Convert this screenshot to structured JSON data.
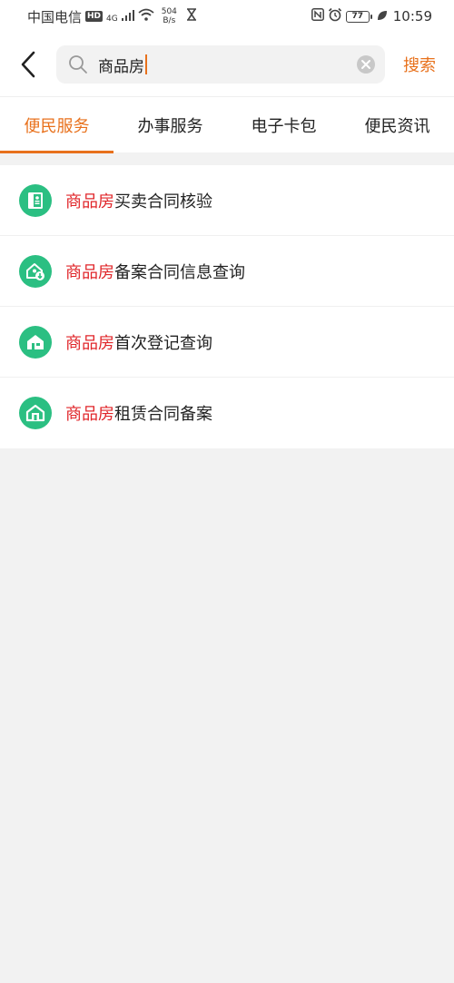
{
  "status_bar": {
    "carrier": "中国电信",
    "hd": "HD",
    "network": "4G",
    "speed_value": "504",
    "speed_unit": "B/s",
    "battery": "77",
    "time": "10:59"
  },
  "search": {
    "query": "商品房",
    "button_label": "搜索"
  },
  "tabs": [
    {
      "label": "便民服务",
      "active": true
    },
    {
      "label": "办事服务",
      "active": false
    },
    {
      "label": "电子卡包",
      "active": false
    },
    {
      "label": "便民资讯",
      "active": false
    }
  ],
  "results": [
    {
      "highlight": "商品房",
      "rest": "买卖合同核验",
      "icon": "contract-icon"
    },
    {
      "highlight": "商品房",
      "rest": "备案合同信息查询",
      "icon": "house-download-icon"
    },
    {
      "highlight": "商品房",
      "rest": "首次登记查询",
      "icon": "house-icon"
    },
    {
      "highlight": "商品房",
      "rest": "租赁合同备案",
      "icon": "house-door-icon"
    }
  ],
  "colors": {
    "accent": "#e8711c",
    "highlight": "#e0262a",
    "icon_bg": "#2bbf82"
  }
}
